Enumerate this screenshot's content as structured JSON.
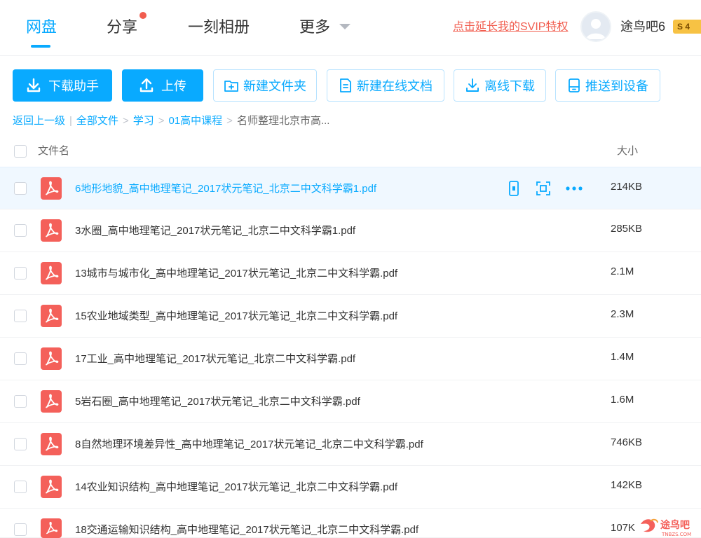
{
  "nav": {
    "tabs": [
      "网盘",
      "分享",
      "一刻相册",
      "更多"
    ],
    "svip_link": "点击延长我的SVIP特权",
    "username": "途鸟吧6",
    "vip_level": "S 4"
  },
  "toolbar": {
    "download_helper": "下载助手",
    "upload": "上传",
    "new_folder": "新建文件夹",
    "new_online_doc": "新建在线文档",
    "offline_download": "离线下载",
    "push_to_device": "推送到设备"
  },
  "breadcrumb": {
    "back": "返回上一级",
    "all_files": "全部文件",
    "level1": "学习",
    "level2": "01高中课程",
    "current": "名师整理北京市高..."
  },
  "table": {
    "col_name": "文件名",
    "col_size": "大小",
    "rows": [
      {
        "name": "6地形地貌_高中地理笔记_2017状元笔记_北京二中文科学霸1.pdf",
        "size": "214KB"
      },
      {
        "name": "3水圈_高中地理笔记_2017状元笔记_北京二中文科学霸1.pdf",
        "size": "285KB"
      },
      {
        "name": "13城市与城市化_高中地理笔记_2017状元笔记_北京二中文科学霸.pdf",
        "size": "2.1M"
      },
      {
        "name": "15农业地域类型_高中地理笔记_2017状元笔记_北京二中文科学霸.pdf",
        "size": "2.3M"
      },
      {
        "name": "17工业_高中地理笔记_2017状元笔记_北京二中文科学霸.pdf",
        "size": "1.4M"
      },
      {
        "name": "5岩石圈_高中地理笔记_2017状元笔记_北京二中文科学霸.pdf",
        "size": "1.6M"
      },
      {
        "name": "8自然地理环境差异性_高中地理笔记_2017状元笔记_北京二中文科学霸.pdf",
        "size": "746KB"
      },
      {
        "name": "14农业知识结构_高中地理笔记_2017状元笔记_北京二中文科学霸.pdf",
        "size": "142KB"
      },
      {
        "name": "18交通运输知识结构_高中地理笔记_2017状元笔记_北京二中文科学霸.pdf",
        "size": "107K"
      }
    ]
  },
  "watermark": {
    "text": "途鸟吧",
    "sub": "TNBZS.COM"
  },
  "colors": {
    "accent": "#09aaff",
    "pdf": "#f4605a",
    "alert": "#f15d4f",
    "badge": "#f7c244"
  }
}
